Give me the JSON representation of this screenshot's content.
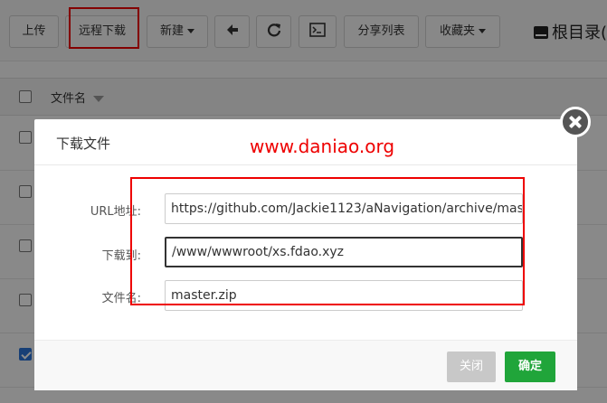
{
  "toolbar": {
    "upload": "上传",
    "remote_download": "远程下载",
    "new": "新建",
    "share_list": "分享列表",
    "favorites": "收藏夹",
    "root_dir": "根目录("
  },
  "file_list": {
    "column_name": "文件名"
  },
  "dialog": {
    "title": "下载文件",
    "watermark": "www.daniao.org",
    "url_label": "URL地址:",
    "url_value": "https://github.com/Jackie1123/aNavigation/archive/mas",
    "dest_label": "下载到:",
    "dest_value": "/www/wwwroot/xs.fdao.xyz",
    "filename_label": "文件名:",
    "filename_value": "master.zip",
    "close_label": "关闭",
    "ok_label": "确定"
  },
  "colors": {
    "accent_green": "#20a53a",
    "highlight_red": "#e00000"
  }
}
